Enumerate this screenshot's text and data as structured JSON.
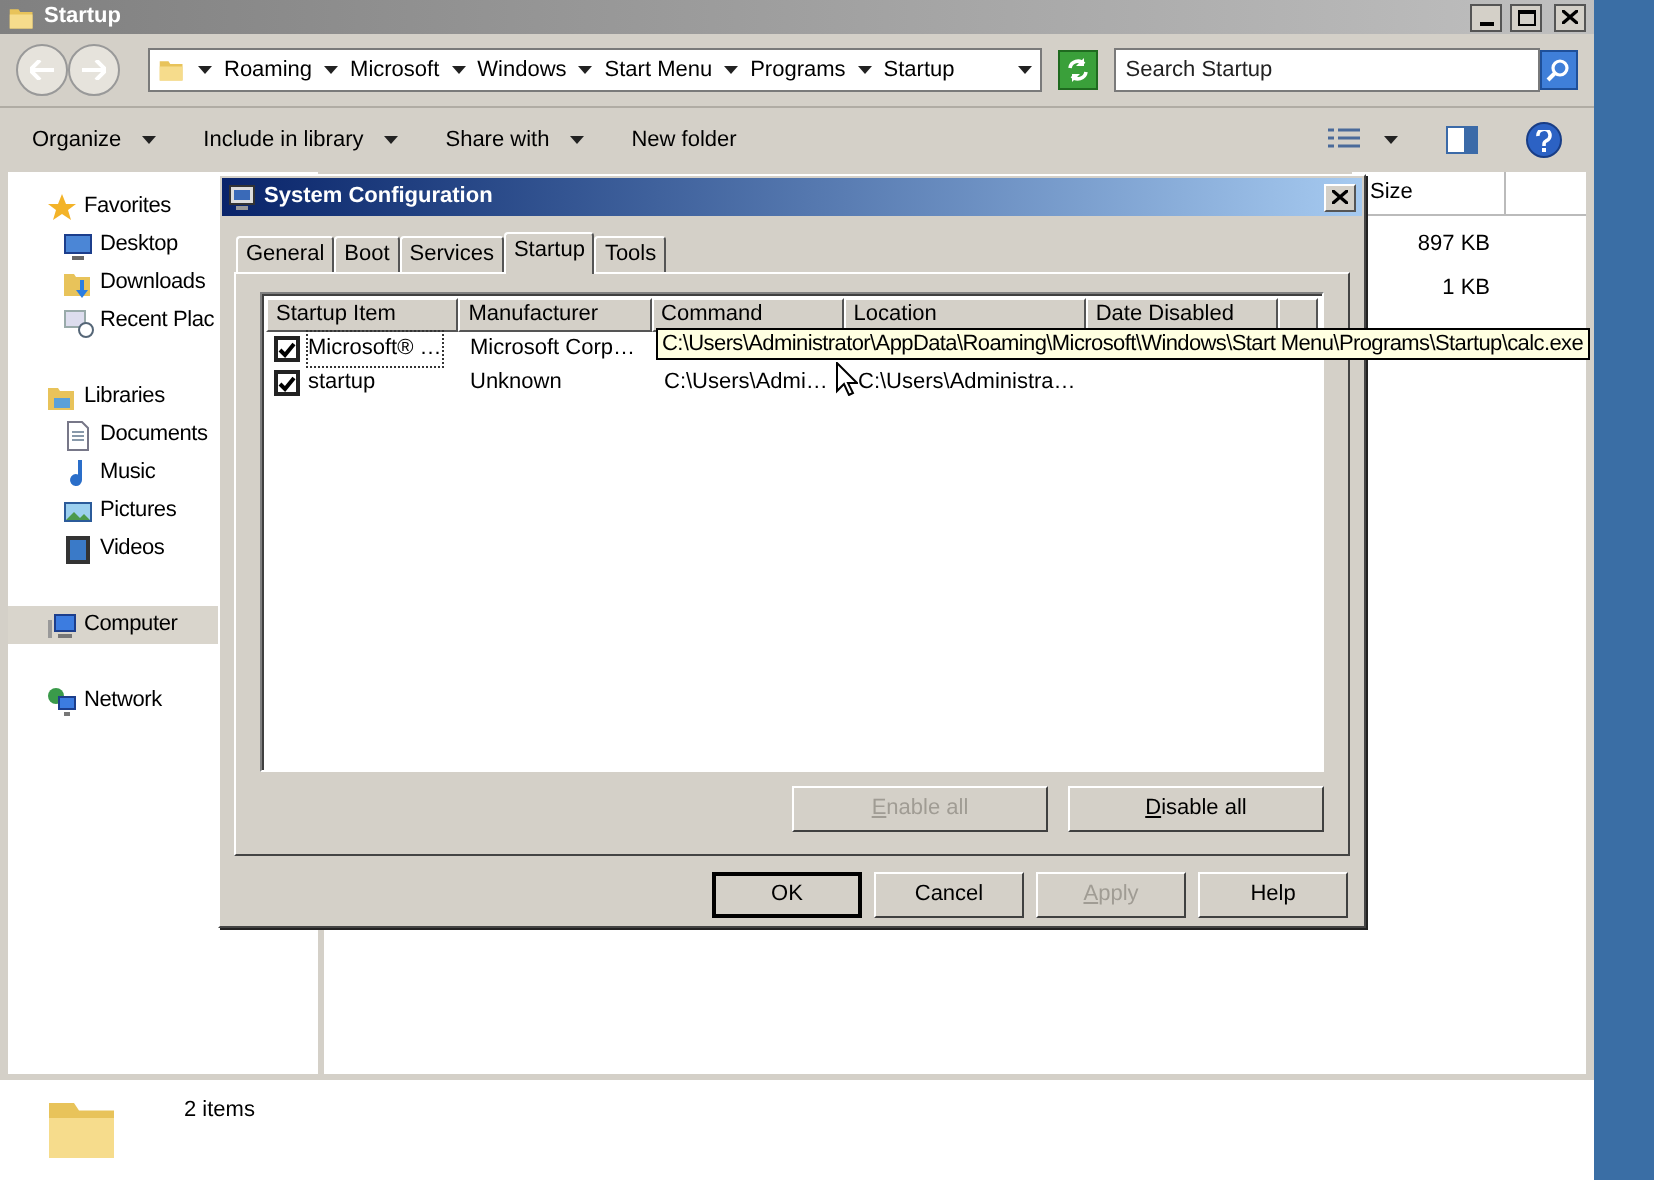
{
  "explorer": {
    "title": "Startup",
    "breadcrumbs": [
      "Roaming",
      "Microsoft",
      "Windows",
      "Start Menu",
      "Programs",
      "Startup"
    ],
    "search": {
      "placeholder": "Search Startup"
    },
    "toolbar": [
      {
        "label": "Organize",
        "dropdown": true
      },
      {
        "label": "Include in library",
        "dropdown": true
      },
      {
        "label": "Share with",
        "dropdown": true
      },
      {
        "label": "New folder",
        "dropdown": false
      }
    ],
    "nav": [
      {
        "label": "Favorites",
        "kind": "group",
        "selected": false,
        "children": [
          {
            "label": "Desktop",
            "kind": "desktop",
            "selected": false
          },
          {
            "label": "Downloads",
            "kind": "downloads",
            "selected": false
          },
          {
            "label": "Recent Plac",
            "kind": "recent",
            "selected": false
          }
        ]
      },
      {
        "label": "Libraries",
        "kind": "libraries",
        "selected": false,
        "children": [
          {
            "label": "Documents",
            "kind": "documents",
            "selected": false
          },
          {
            "label": "Music",
            "kind": "music",
            "selected": false
          },
          {
            "label": "Pictures",
            "kind": "pictures",
            "selected": false
          },
          {
            "label": "Videos",
            "kind": "videos",
            "selected": false
          }
        ]
      },
      {
        "label": "Computer",
        "kind": "computer",
        "selected": true
      },
      {
        "label": "Network",
        "kind": "network",
        "selected": false
      }
    ],
    "columns": [
      "Size"
    ],
    "files": [
      {
        "size": "897 KB"
      },
      {
        "size": "1 KB"
      }
    ],
    "status": "2 items"
  },
  "dialog": {
    "title": "System Configuration",
    "tabs": [
      {
        "label": "General",
        "selected": false
      },
      {
        "label": "Boot",
        "selected": false
      },
      {
        "label": "Services",
        "selected": false
      },
      {
        "label": "Startup",
        "selected": true
      },
      {
        "label": "Tools",
        "selected": false
      }
    ],
    "columns": [
      "Startup Item",
      "Manufacturer",
      "Command",
      "Location",
      "Date Disabled"
    ],
    "rows": [
      {
        "checked": true,
        "focused": true,
        "item": "Microsoft® …",
        "manufacturer": "Microsoft Corp…"
      },
      {
        "checked": true,
        "focused": false,
        "item": "startup",
        "manufacturer": "Unknown",
        "command": "C:\\Users\\Admi…",
        "location": "C:\\Users\\Administra…"
      }
    ],
    "list_buttons": [
      {
        "label": "Enable all",
        "disabled": true
      },
      {
        "label": "Disable all",
        "disabled": false
      }
    ],
    "buttons": [
      {
        "label": "OK",
        "default": true,
        "disabled": false
      },
      {
        "label": "Cancel",
        "default": false,
        "disabled": false
      },
      {
        "label": "Apply",
        "default": false,
        "disabled": true
      },
      {
        "label": "Help",
        "default": false,
        "disabled": false
      }
    ],
    "tooltip": "C:\\Users\\Administrator\\AppData\\Roaming\\Microsoft\\Windows\\Start Menu\\Programs\\Startup\\calc.exe"
  }
}
